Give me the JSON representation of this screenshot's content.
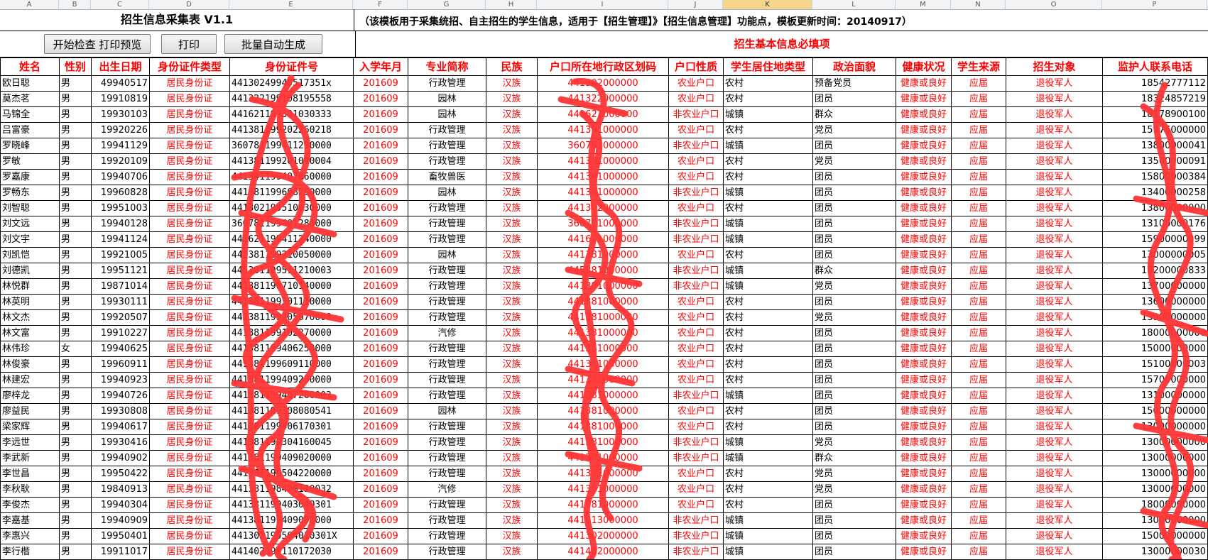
{
  "columns": [
    "A",
    "B",
    "C",
    "D",
    "E",
    "F",
    "G",
    "H",
    "I",
    "J",
    "K",
    "L",
    "M",
    "N",
    "O",
    "P"
  ],
  "selected_column": "K",
  "title": "招生信息采集表 V1.1",
  "note": "（该模板用于采集统招、自主招生的学生信息，适用于【招生管理】》【招生信息管理】功能点，模板更新时间：20140917）",
  "buttons": {
    "check": "开始检查 打印预览",
    "print": "打印",
    "batch": "批量自动生成"
  },
  "required_label": "招生基本信息必填项",
  "headers": [
    "姓名",
    "性别",
    "出生日期",
    "身份证件类型",
    "身份证件号",
    "入学年月",
    "专业简称",
    "民族",
    "户口所在地行政区划码",
    "户口性质",
    "学生居住地类型",
    "政治面貌",
    "健康状况",
    "学生来源",
    "招生对象",
    "监护人联系电话"
  ],
  "rows": [
    [
      "欧日聪",
      "男",
      "49940517",
      "居民身份证",
      "44130249940517351x",
      "201609",
      "行政管理",
      "汉族",
      "441302000000",
      "农业户口",
      "农村",
      "预备党员",
      "健康或良好",
      "应届",
      "退役军人",
      "18542777112"
    ],
    [
      "莫杰茗",
      "男",
      "19910819",
      "居民身份证",
      "441322199108195558",
      "201609",
      "园林",
      "汉族",
      "441322000000",
      "农业户口",
      "农村",
      "团员",
      "健康或良好",
      "应届",
      "退役军人",
      "18324857219"
    ],
    [
      "马锦全",
      "男",
      "19930103",
      "居民身份证",
      "441621199301030333",
      "201609",
      "园林",
      "汉族",
      "441621000000",
      "非农业户口",
      "城镇",
      "群众",
      "健康或良好",
      "应届",
      "退役军人",
      "18178900100"
    ],
    [
      "吕富豪",
      "男",
      "19920226",
      "居民身份证",
      "441381199202260218",
      "201609",
      "行政管理",
      "汉族",
      "441381000000",
      "农业户口",
      "农村",
      "党员",
      "健康或良好",
      "应届",
      "退役军人",
      "15976000000"
    ],
    [
      "罗晓峰",
      "男",
      "19941129",
      "居民身份证",
      "360781199411290000",
      "201609",
      "行政管理",
      "汉族",
      "360781000000",
      "非农业户口",
      "城镇",
      "团员",
      "健康或良好",
      "应届",
      "退役军人",
      "13800000041"
    ],
    [
      "罗敏",
      "男",
      "19920109",
      "居民身份证",
      "441381199201090004",
      "201609",
      "行政管理",
      "汉族",
      "441381000000",
      "农业户口",
      "农村",
      "党员",
      "健康或良好",
      "应届",
      "退役军人",
      "13500000091"
    ],
    [
      "罗嘉康",
      "男",
      "19940706",
      "居民身份证",
      "441341199407060000",
      "201609",
      "畜牧兽医",
      "汉族",
      "441341000000",
      "农业户口",
      "农村",
      "团员",
      "健康或良好",
      "应届",
      "退役军人",
      "15800000384"
    ],
    [
      "罗畅东",
      "男",
      "19960828",
      "居民身份证",
      "441381199608280000",
      "201609",
      "园林",
      "汉族",
      "441381000000",
      "非农业户口",
      "城镇",
      "团员",
      "健康或良好",
      "应届",
      "退役军人",
      "13400000258"
    ],
    [
      "刘智聪",
      "男",
      "19951003",
      "居民身份证",
      "441302199510030000",
      "201609",
      "行政管理",
      "汉族",
      "441302000000",
      "农业户口",
      "农村",
      "团员",
      "健康或良好",
      "应届",
      "退役军人",
      "13800000000"
    ],
    [
      "刘文远",
      "男",
      "19940128",
      "居民身份证",
      "360781199401280000",
      "201609",
      "行政管理",
      "汉族",
      "360781000000",
      "非农业户口",
      "城镇",
      "团员",
      "健康或良好",
      "应届",
      "退役军人",
      "13100000176"
    ],
    [
      "刘文宇",
      "男",
      "19941124",
      "居民身份证",
      "441621199411240000",
      "201609",
      "行政管理",
      "汉族",
      "441621000000",
      "非农业户口",
      "城镇",
      "团员",
      "健康或良好",
      "应届",
      "退役军人",
      "15900000099"
    ],
    [
      "刘凯恺",
      "男",
      "19921005",
      "居民身份证",
      "441381199210050000",
      "201609",
      "园林",
      "汉族",
      "441381000000",
      "农业户口",
      "农村",
      "团员",
      "健康或良好",
      "应届",
      "退役军人",
      "13000000005"
    ],
    [
      "刘德凯",
      "男",
      "19951121",
      "居民身份证",
      "445381199511210003",
      "201609",
      "行政管理",
      "汉族",
      "445381000000",
      "非农业户口",
      "城镇",
      "群众",
      "健康或良好",
      "应届",
      "退役军人",
      "18200000833"
    ],
    [
      "林悦群",
      "男",
      "19871014",
      "居民身份证",
      "441381198710140000",
      "201609",
      "行政管理",
      "汉族",
      "441381000000",
      "非农业户口",
      "城镇",
      "党员",
      "健康或良好",
      "应届",
      "退役军人",
      "13700000000"
    ],
    [
      "林英明",
      "男",
      "19930111",
      "居民身份证",
      "441381199301110000",
      "201609",
      "行政管理",
      "汉族",
      "441381000000",
      "农业户口",
      "农村",
      "团员",
      "健康或良好",
      "应届",
      "退役军人",
      "13600000000"
    ],
    [
      "林文杰",
      "男",
      "19920507",
      "居民身份证",
      "441381199205070000",
      "201609",
      "行政管理",
      "汉族",
      "441381000000",
      "农业户口",
      "农村",
      "党员",
      "健康或良好",
      "应届",
      "退役军人",
      "13900000000"
    ],
    [
      "林文富",
      "男",
      "19910227",
      "居民身份证",
      "441381199102270000",
      "201609",
      "汽修",
      "汉族",
      "441381000000",
      "农业户口",
      "农村",
      "团员",
      "健康或良好",
      "应届",
      "退役军人",
      "18000000000"
    ],
    [
      "林伟珍",
      "女",
      "19940625",
      "居民身份证",
      "441381199406250000",
      "201609",
      "行政管理",
      "汉族",
      "441381000000",
      "农业户口",
      "农村",
      "团员",
      "健康或良好",
      "应届",
      "退役军人",
      "15000000000"
    ],
    [
      "林俊豪",
      "男",
      "19960911",
      "居民身份证",
      "441381199609110000",
      "201609",
      "行政管理",
      "汉族",
      "441381000000",
      "农业户口",
      "农村",
      "团员",
      "健康或良好",
      "应届",
      "退役军人",
      "15100000003"
    ],
    [
      "林建宏",
      "男",
      "19940923",
      "居民身份证",
      "441381199409230000",
      "201609",
      "行政管理",
      "汉族",
      "441381000000",
      "农业户口",
      "农村",
      "团员",
      "健康或良好",
      "应届",
      "退役军人",
      "15700000000"
    ],
    [
      "廖梓龙",
      "男",
      "19940726",
      "居民身份证",
      "441381199407260003",
      "201609",
      "行政管理",
      "汉族",
      "441381000000",
      "非农业户口",
      "城镇",
      "团员",
      "健康或良好",
      "应届",
      "退役军人",
      "13100000000"
    ],
    [
      "廖益民",
      "男",
      "19930808",
      "居民身份证",
      "441381199308080541",
      "201609",
      "园林",
      "汉族",
      "441381000000",
      "农业户口",
      "农村",
      "团员",
      "健康或良好",
      "应届",
      "退役军人",
      "15000000000"
    ],
    [
      "梁家辉",
      "男",
      "19940617",
      "居民身份证",
      "441381199406170301",
      "201609",
      "行政管理",
      "汉族",
      "441381000000",
      "农业户口",
      "农村",
      "团员",
      "健康或良好",
      "应届",
      "退役军人",
      "13000000000"
    ],
    [
      "李远世",
      "男",
      "19930416",
      "居民身份证",
      "441381199304160045",
      "201609",
      "行政管理",
      "汉族",
      "441381000000",
      "非农业户口",
      "城镇",
      "党员",
      "健康或良好",
      "应届",
      "退役军人",
      "13000000000"
    ],
    [
      "李武新",
      "男",
      "19940902",
      "居民身份证",
      "441381199409020000",
      "201609",
      "行政管理",
      "汉族",
      "441381000000",
      "非农业户口",
      "城镇",
      "群众",
      "健康或良好",
      "应届",
      "退役军人",
      "13000000000"
    ],
    [
      "李世昌",
      "男",
      "19950422",
      "居民身份证",
      "441381199504220000",
      "201609",
      "行政管理",
      "汉族",
      "441381000000",
      "农业户口",
      "农村",
      "党员",
      "健康或良好",
      "应届",
      "退役军人",
      "13000000000"
    ],
    [
      "李秋耿",
      "男",
      "19840913",
      "居民身份证",
      "441381198409130032",
      "201609",
      "汽修",
      "汉族",
      "441381000000",
      "农业户口",
      "农村",
      "党员",
      "健康或良好",
      "应届",
      "退役军人",
      "13000000000"
    ],
    [
      "李俊杰",
      "男",
      "19940304",
      "居民身份证",
      "441381199403040301",
      "201609",
      "行政管理",
      "汉族",
      "441381000000",
      "农业户口",
      "农村",
      "团员",
      "健康或良好",
      "应届",
      "退役军人",
      "18000000000"
    ],
    [
      "李嘉基",
      "男",
      "19940909",
      "居民身份证",
      "441381199409090000",
      "201609",
      "行政管理",
      "汉族",
      "441613000000",
      "非农业户口",
      "城镇",
      "团员",
      "健康或良好",
      "应届",
      "退役军人",
      "13000000000"
    ],
    [
      "李惠兴",
      "男",
      "19950401",
      "居民身份证",
      "441302199504010301X",
      "201609",
      "行政管理",
      "汉族",
      "441302000000",
      "非农业户口",
      "城镇",
      "团员",
      "健康或良好",
      "应届",
      "退役军人",
      "15000000000"
    ],
    [
      "李行楷",
      "男",
      "19911017",
      "居民身份证",
      "441402199110172030",
      "201609",
      "行政管理",
      "汉族",
      "441402000000",
      "非农业户口",
      "城镇",
      "团员",
      "健康或良好",
      "应届",
      "退役军人",
      "13000000030"
    ]
  ]
}
